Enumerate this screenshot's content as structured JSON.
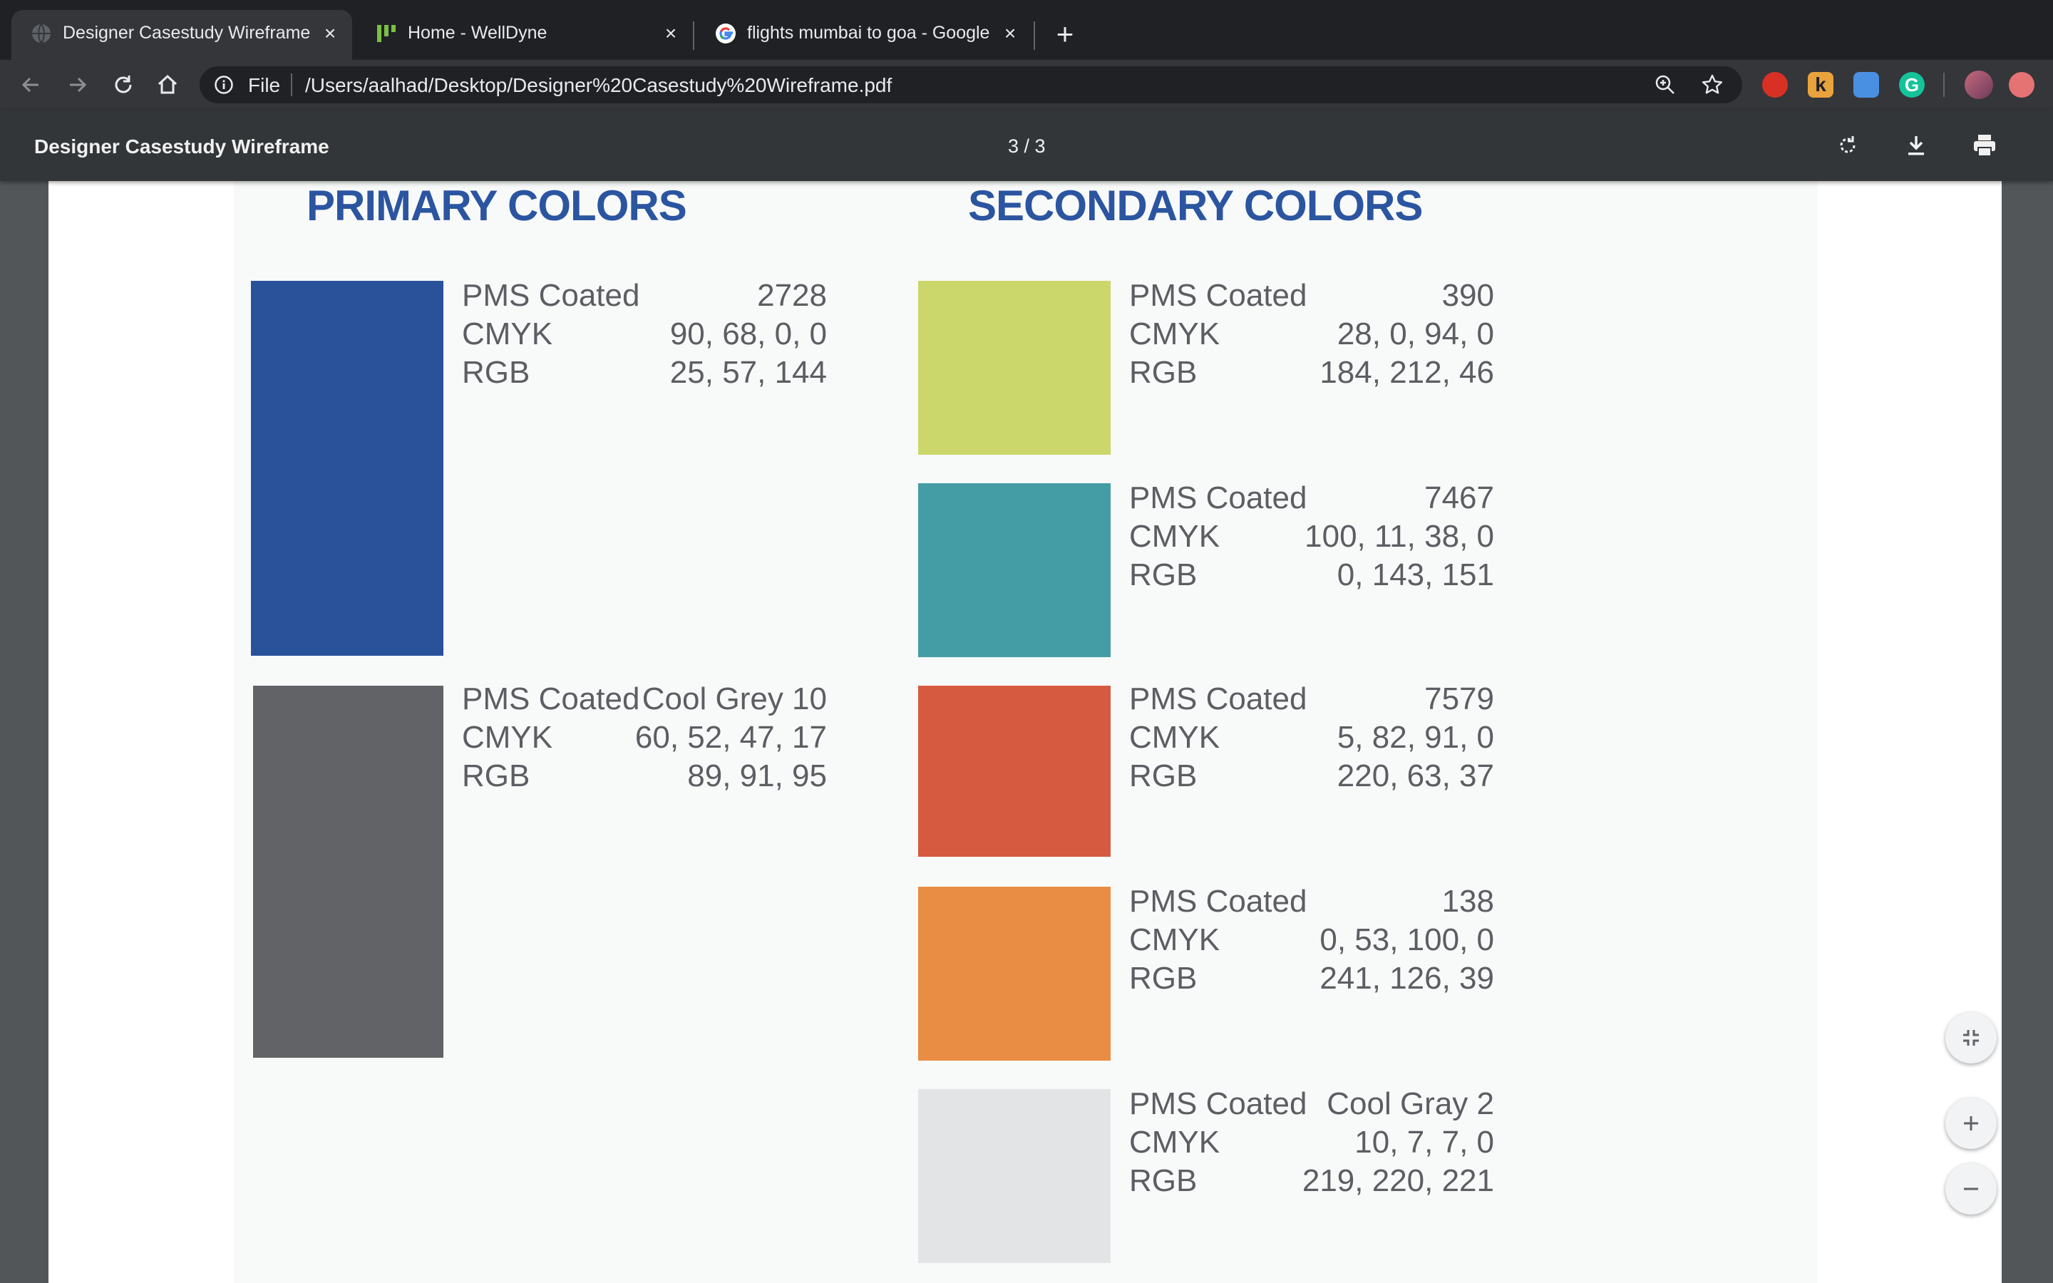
{
  "tabs": [
    {
      "title": "Designer Casestudy Wireframe",
      "active": true,
      "favicon": "globe-icon"
    },
    {
      "title": "Home - WellDyne",
      "active": false,
      "favicon": "welldyne-icon"
    },
    {
      "title": "flights mumbai to goa - Google",
      "active": false,
      "favicon": "google-icon"
    }
  ],
  "omnibox": {
    "scheme_label": "File",
    "url": "/Users/aalhad/Desktop/Designer%20Casestudy%20Wireframe.pdf"
  },
  "pdf_viewer": {
    "title": "Designer Casestudy Wireframe",
    "page_indicator": "3 / 3"
  },
  "document": {
    "primary_title": "PRIMARY COLORS",
    "secondary_title": "SECONDARY COLORS",
    "labels": {
      "pms": "PMS Coated",
      "cmyk": "CMYK",
      "rgb": "RGB"
    },
    "primary": [
      {
        "pms": "2728",
        "cmyk": "90, 68, 0, 0",
        "rgb": "25, 57, 144",
        "color": "#29529b"
      },
      {
        "pms": "Cool Grey 10",
        "cmyk": "60, 52, 47, 17",
        "rgb": "89, 91, 95",
        "color": "#626366"
      }
    ],
    "secondary": [
      {
        "pms": "390",
        "cmyk": "28, 0, 94, 0",
        "rgb": "184, 212, 46",
        "color": "#cbd76a"
      },
      {
        "pms": "7467",
        "cmyk": "100, 11, 38, 0",
        "rgb": "0, 143, 151",
        "color": "#449da5"
      },
      {
        "pms": "7579",
        "cmyk": "5, 82, 91, 0",
        "rgb": "220, 63, 37",
        "color": "#d65a3f"
      },
      {
        "pms": "138",
        "cmyk": "0, 53, 100, 0",
        "rgb": "241, 126, 39",
        "color": "#e98d45"
      },
      {
        "pms": "Cool Gray 2",
        "cmyk": "10, 7, 7, 0",
        "rgb": "219, 220, 221",
        "color": "#e3e4e6"
      }
    ]
  }
}
